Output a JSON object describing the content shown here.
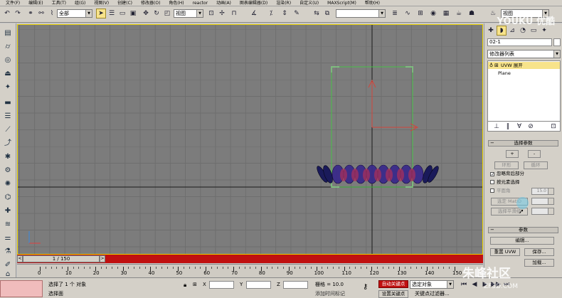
{
  "menubar": {
    "items": [
      "文件(F)",
      "编辑(E)",
      "工具(T)",
      "组(G)",
      "视图(V)",
      "创建(C)",
      "修改器(O)",
      "角色(H)",
      "reactor",
      "动画(A)",
      "图表编辑器(D)",
      "渲染(R)",
      "自定义(U)",
      "MAXScript(M)",
      "帮助(H)"
    ]
  },
  "toolbar": {
    "selection_filter": "全部",
    "ref_coord": "视图",
    "named_selection": "",
    "right_dropdown": "视图",
    "icons": [
      "undo-icon",
      "redo-icon",
      "link-icon",
      "unlink-icon",
      "bind-icon",
      "filter-icon",
      "select-icon",
      "select-name-icon",
      "rect-select-icon",
      "window-icon",
      "move-icon",
      "rotate-icon",
      "scale-icon",
      "pivot-icon",
      "snap3d-icon",
      "angle-snap-icon",
      "percent-snap-icon",
      "spinner-snap-icon",
      "named-sel-icon",
      "mirror-icon",
      "align-icon",
      "layer-icon",
      "curve-icon",
      "schematic-icon",
      "material-icon",
      "render-setup-icon",
      "quick-render-icon"
    ]
  },
  "left_toolbar": {
    "icons": [
      "box-icon",
      "cylinder-icon",
      "sphere-icon",
      "cone-icon",
      "star-icon",
      "plane-icon",
      "layers-icon",
      "pipe-icon",
      "path-icon",
      "wrench-icon",
      "gear-icon",
      "light-icon",
      "camera-icon",
      "helper-icon",
      "wave-icon",
      "bone-icon",
      "system-icon",
      "paint-icon",
      "cloth-icon"
    ]
  },
  "viewport": {
    "name": "viewport-perspective"
  },
  "scrollbar": {
    "frame": "1 / 150",
    "prev": "<",
    "next": ">"
  },
  "timeline": {
    "labels": [
      "0",
      "10",
      "20",
      "30",
      "40",
      "50",
      "60",
      "70",
      "80",
      "90",
      "100",
      "110",
      "120",
      "130",
      "140",
      "150"
    ]
  },
  "panel": {
    "object_name": "02-1",
    "modifier_list": "修改器列表",
    "stack": [
      {
        "label": "UVW 展开",
        "active": true
      },
      {
        "label": "Plane",
        "active": false
      }
    ],
    "selection_rollout": {
      "title": "选择参数",
      "plus": "+",
      "minus": "-",
      "ring": "环形",
      "loop": "循环",
      "ignore_backfaces": "忽略背后部分",
      "by_element": "按元素选择",
      "planar_angle": "平面角",
      "planar_value": "15.0",
      "select_matid": "选定 MatID",
      "select_smooth": "选择平滑组"
    },
    "params_rollout": {
      "title": "参数",
      "edit": "编辑...",
      "reset_uvw": "重置 UVW",
      "save": "保存...",
      "load": "加载..."
    }
  },
  "status": {
    "selected_text": "选择了 1 个 对象",
    "prompt_text": "选择面",
    "lock_icon": "lock-icon",
    "x_label": "X",
    "y_label": "Y",
    "z_label": "Z",
    "x_value": "",
    "y_value": "",
    "z_value": "",
    "grid": "栅格 = 10.0",
    "auto_key": "自动关键点",
    "set_key": "设置关键点",
    "selected_object": "选定对象",
    "key_filters": "关键点过滤器...",
    "add_time_tag": "添加时间标记"
  },
  "watermark": {
    "youku": "YOUKU 优酷",
    "site_name": "朱峰社区",
    "site_url": "ZF3D.COM"
  },
  "colors": {
    "ui_gray": "#d4d0c8",
    "viewport_bg": "#7c7c7c",
    "viewport_border": "#e8d000",
    "time_slider_red": "#c01010",
    "stack_highlight": "#f7e38a",
    "auto_key_red": "#c01010"
  }
}
